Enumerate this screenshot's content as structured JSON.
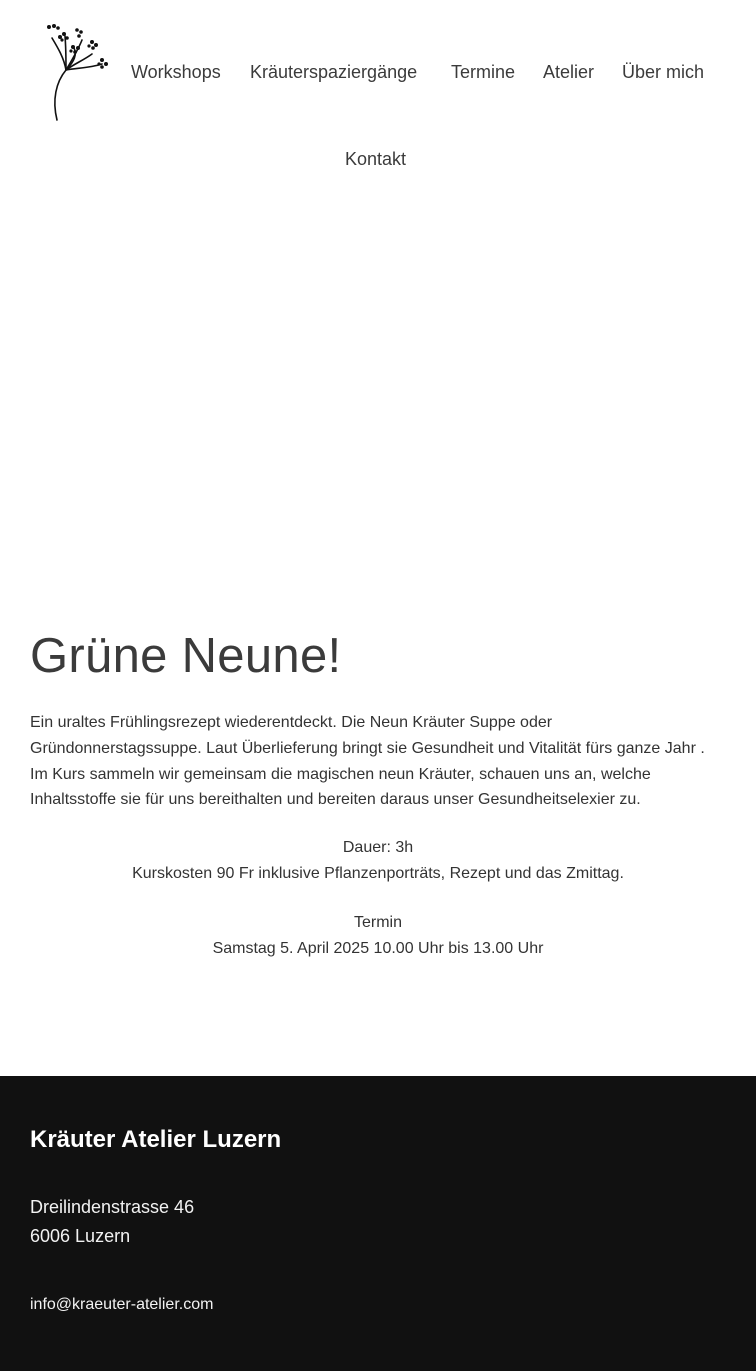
{
  "nav": {
    "logo_icon": "dandelion-logo-icon",
    "items": [
      {
        "label": "Workshops"
      },
      {
        "label": "Kräuterspaziergänge"
      },
      {
        "label": "Termine"
      },
      {
        "label": "Atelier"
      },
      {
        "label": "Über mich"
      },
      {
        "label": "Kontakt"
      }
    ]
  },
  "article": {
    "title": "Grüne Neune!",
    "intro": "Ein uraltes Frühlingsrezept wiederentdeckt. Die Neun Kräuter Suppe oder Gründonnerstagssuppe. Laut Überlieferung bringt sie Gesundheit und Vitalität fürs ganze Jahr . Im Kurs sammeln wir gemeinsam die magischen neun Kräuter, schauen uns an, welche Inhaltsstoffe sie für uns bereithalten und bereiten daraus unser Gesundheitselexier zu.",
    "duration": "Dauer: 3h",
    "cost": "Kurskosten 90 Fr inklusive Pflanzenporträts, Rezept und das Zmittag.",
    "date_label": "Termin",
    "date_value": "Samstag 5. April 2025 10.00 Uhr bis 13.00 Uhr"
  },
  "footer": {
    "title": "Kräuter Atelier Luzern",
    "street": "Dreilindenstrasse 46",
    "city": "6006 Luzern",
    "email": "info@kraeuter-atelier.com"
  },
  "colors": {
    "text": "#3b3b3b",
    "footer_bg": "#111111",
    "footer_text": "#ffffff",
    "background": "#ffffff"
  }
}
